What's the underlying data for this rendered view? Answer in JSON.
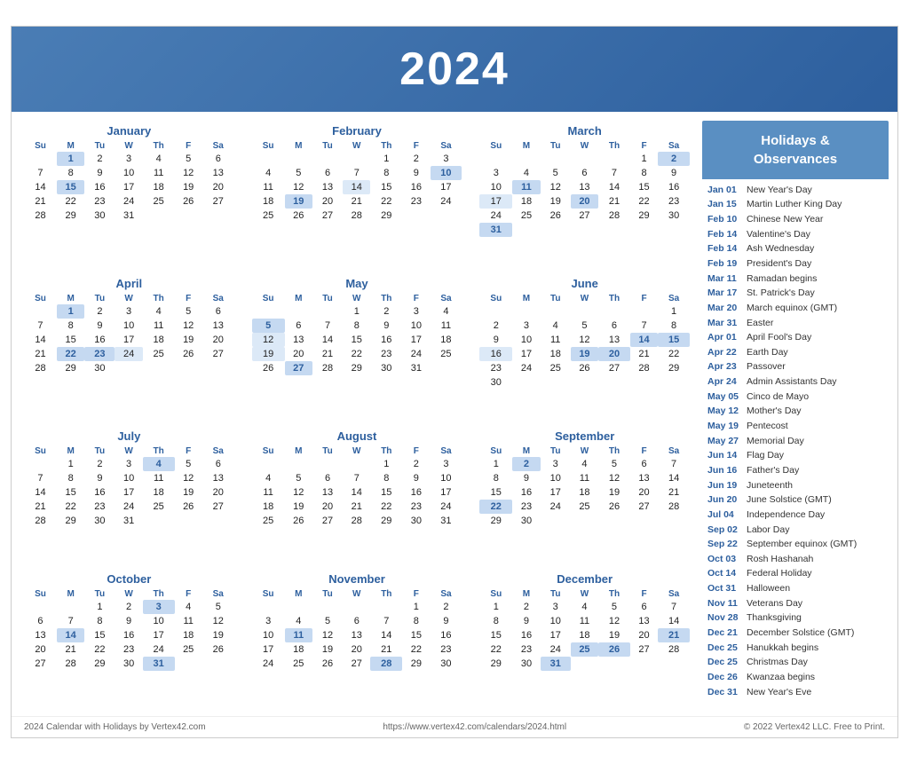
{
  "header": {
    "year": "2024"
  },
  "sidebar": {
    "title": "Holidays &\nObservances",
    "holidays": [
      {
        "date": "Jan 01",
        "name": "New Year's Day"
      },
      {
        "date": "Jan 15",
        "name": "Martin Luther King Day"
      },
      {
        "date": "Feb 10",
        "name": "Chinese New Year"
      },
      {
        "date": "Feb 14",
        "name": "Valentine's Day"
      },
      {
        "date": "Feb 14",
        "name": "Ash Wednesday"
      },
      {
        "date": "Feb 19",
        "name": "President's Day"
      },
      {
        "date": "Mar 11",
        "name": "Ramadan begins"
      },
      {
        "date": "Mar 17",
        "name": "St. Patrick's Day"
      },
      {
        "date": "Mar 20",
        "name": "March equinox (GMT)"
      },
      {
        "date": "Mar 31",
        "name": "Easter"
      },
      {
        "date": "Apr 01",
        "name": "April Fool's Day"
      },
      {
        "date": "Apr 22",
        "name": "Earth Day"
      },
      {
        "date": "Apr 23",
        "name": "Passover"
      },
      {
        "date": "Apr 24",
        "name": "Admin Assistants Day"
      },
      {
        "date": "May 05",
        "name": "Cinco de Mayo"
      },
      {
        "date": "May 12",
        "name": "Mother's Day"
      },
      {
        "date": "May 19",
        "name": "Pentecost"
      },
      {
        "date": "May 27",
        "name": "Memorial Day"
      },
      {
        "date": "Jun 14",
        "name": "Flag Day"
      },
      {
        "date": "Jun 16",
        "name": "Father's Day"
      },
      {
        "date": "Jun 19",
        "name": "Juneteenth"
      },
      {
        "date": "Jun 20",
        "name": "June Solstice (GMT)"
      },
      {
        "date": "Jul 04",
        "name": "Independence Day"
      },
      {
        "date": "Sep 02",
        "name": "Labor Day"
      },
      {
        "date": "Sep 22",
        "name": "September equinox (GMT)"
      },
      {
        "date": "Oct 03",
        "name": "Rosh Hashanah"
      },
      {
        "date": "Oct 14",
        "name": "Federal Holiday"
      },
      {
        "date": "Oct 31",
        "name": "Halloween"
      },
      {
        "date": "Nov 11",
        "name": "Veterans Day"
      },
      {
        "date": "Nov 28",
        "name": "Thanksgiving"
      },
      {
        "date": "Dec 21",
        "name": "December Solstice (GMT)"
      },
      {
        "date": "Dec 25",
        "name": "Hanukkah begins"
      },
      {
        "date": "Dec 25",
        "name": "Christmas Day"
      },
      {
        "date": "Dec 26",
        "name": "Kwanzaa begins"
      },
      {
        "date": "Dec 31",
        "name": "New Year's Eve"
      }
    ]
  },
  "footer": {
    "left": "2024 Calendar with Holidays by Vertex42.com",
    "center": "https://www.vertex42.com/calendars/2024.html",
    "right": "© 2022 Vertex42 LLC. Free to Print."
  },
  "months": [
    {
      "name": "January",
      "startDay": 1,
      "days": 31,
      "highlights": [
        1,
        15
      ],
      "light": []
    },
    {
      "name": "February",
      "startDay": 4,
      "days": 29,
      "highlights": [
        10,
        14,
        19
      ],
      "light": []
    },
    {
      "name": "March",
      "startDay": 5,
      "days": 31,
      "highlights": [
        2,
        11,
        17,
        20,
        31
      ],
      "light": []
    },
    {
      "name": "April",
      "startDay": 1,
      "days": 30,
      "highlights": [
        1,
        22,
        23,
        24
      ],
      "light": []
    },
    {
      "name": "May",
      "startDay": 3,
      "days": 31,
      "highlights": [
        5,
        12,
        19,
        27
      ],
      "light": []
    },
    {
      "name": "June",
      "startDay": 6,
      "days": 30,
      "highlights": [
        14,
        15,
        16,
        19,
        20
      ],
      "light": []
    },
    {
      "name": "July",
      "startDay": 1,
      "days": 31,
      "highlights": [
        4
      ],
      "light": []
    },
    {
      "name": "August",
      "startDay": 4,
      "days": 31,
      "highlights": [],
      "light": []
    },
    {
      "name": "September",
      "startDay": 0,
      "days": 30,
      "highlights": [
        2,
        22
      ],
      "light": []
    },
    {
      "name": "October",
      "startDay": 2,
      "days": 31,
      "highlights": [
        3,
        14,
        31
      ],
      "light": []
    },
    {
      "name": "November",
      "startDay": 5,
      "days": 30,
      "highlights": [
        11,
        28
      ],
      "light": []
    },
    {
      "name": "December",
      "startDay": 0,
      "days": 31,
      "highlights": [
        21,
        25,
        26,
        31
      ],
      "light": []
    }
  ]
}
